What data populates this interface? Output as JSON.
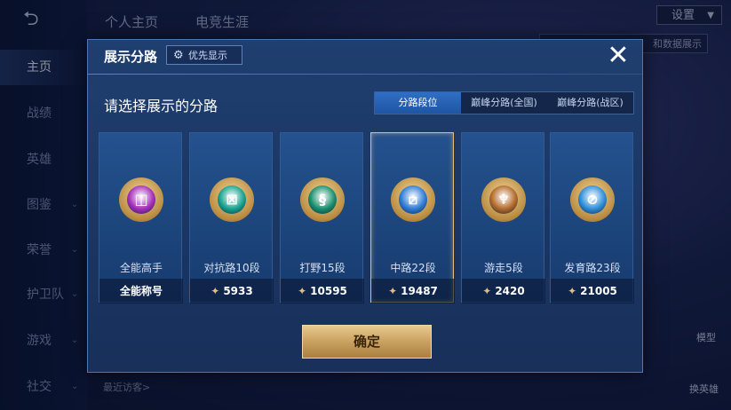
{
  "background": {
    "back_icon": "back-arrow-icon",
    "sidebar": [
      {
        "label": "主页",
        "active": true
      },
      {
        "label": "战绩",
        "active": false
      },
      {
        "label": "英雄",
        "active": false
      },
      {
        "label": "图鉴",
        "active": false,
        "chevron": true
      },
      {
        "label": "荣誉",
        "active": false,
        "chevron": true
      },
      {
        "label": "护卫队",
        "active": false,
        "chevron": true
      },
      {
        "label": "游戏",
        "active": false,
        "chevron": true
      },
      {
        "label": "社交",
        "active": false,
        "chevron": true
      }
    ],
    "top_tabs": [
      "个人主页",
      "电竞生涯"
    ],
    "settings_label": "设置",
    "data_chip": "和数据展示",
    "recent_visitors": "最近访客>",
    "model_label": "模型",
    "swap_hero_label": "换英雄"
  },
  "modal": {
    "title": "展示分路",
    "priority_label": "优先显示",
    "close_icon": "close-icon",
    "subtitle": "请选择展示的分路",
    "tabs": [
      {
        "label": "分路段位",
        "active": true
      },
      {
        "label": "巅峰分路(全国)",
        "active": false
      },
      {
        "label": "巅峰分路(战区)",
        "active": false
      }
    ],
    "cards": [
      {
        "name": "全能高手",
        "footer": "全能称号",
        "has_points": false,
        "color": "#a52fb8",
        "glyph": "◫",
        "selected": false
      },
      {
        "name": "对抗路10段",
        "footer": "5933",
        "has_points": true,
        "color": "#17a38f",
        "glyph": "⊠",
        "selected": false
      },
      {
        "name": "打野15段",
        "footer": "10595",
        "has_points": true,
        "color": "#1a8f6c",
        "glyph": "§",
        "selected": false
      },
      {
        "name": "中路22段",
        "footer": "19487",
        "has_points": true,
        "color": "#2f7bd6",
        "glyph": "⧄",
        "selected": true
      },
      {
        "name": "游走5段",
        "footer": "2420",
        "has_points": true,
        "color": "#b36a2a",
        "glyph": "♆",
        "selected": false
      },
      {
        "name": "发育路23段",
        "footer": "21005",
        "has_points": true,
        "color": "#2f8ed8",
        "glyph": "⊘",
        "selected": false
      }
    ],
    "confirm_label": "确定"
  }
}
